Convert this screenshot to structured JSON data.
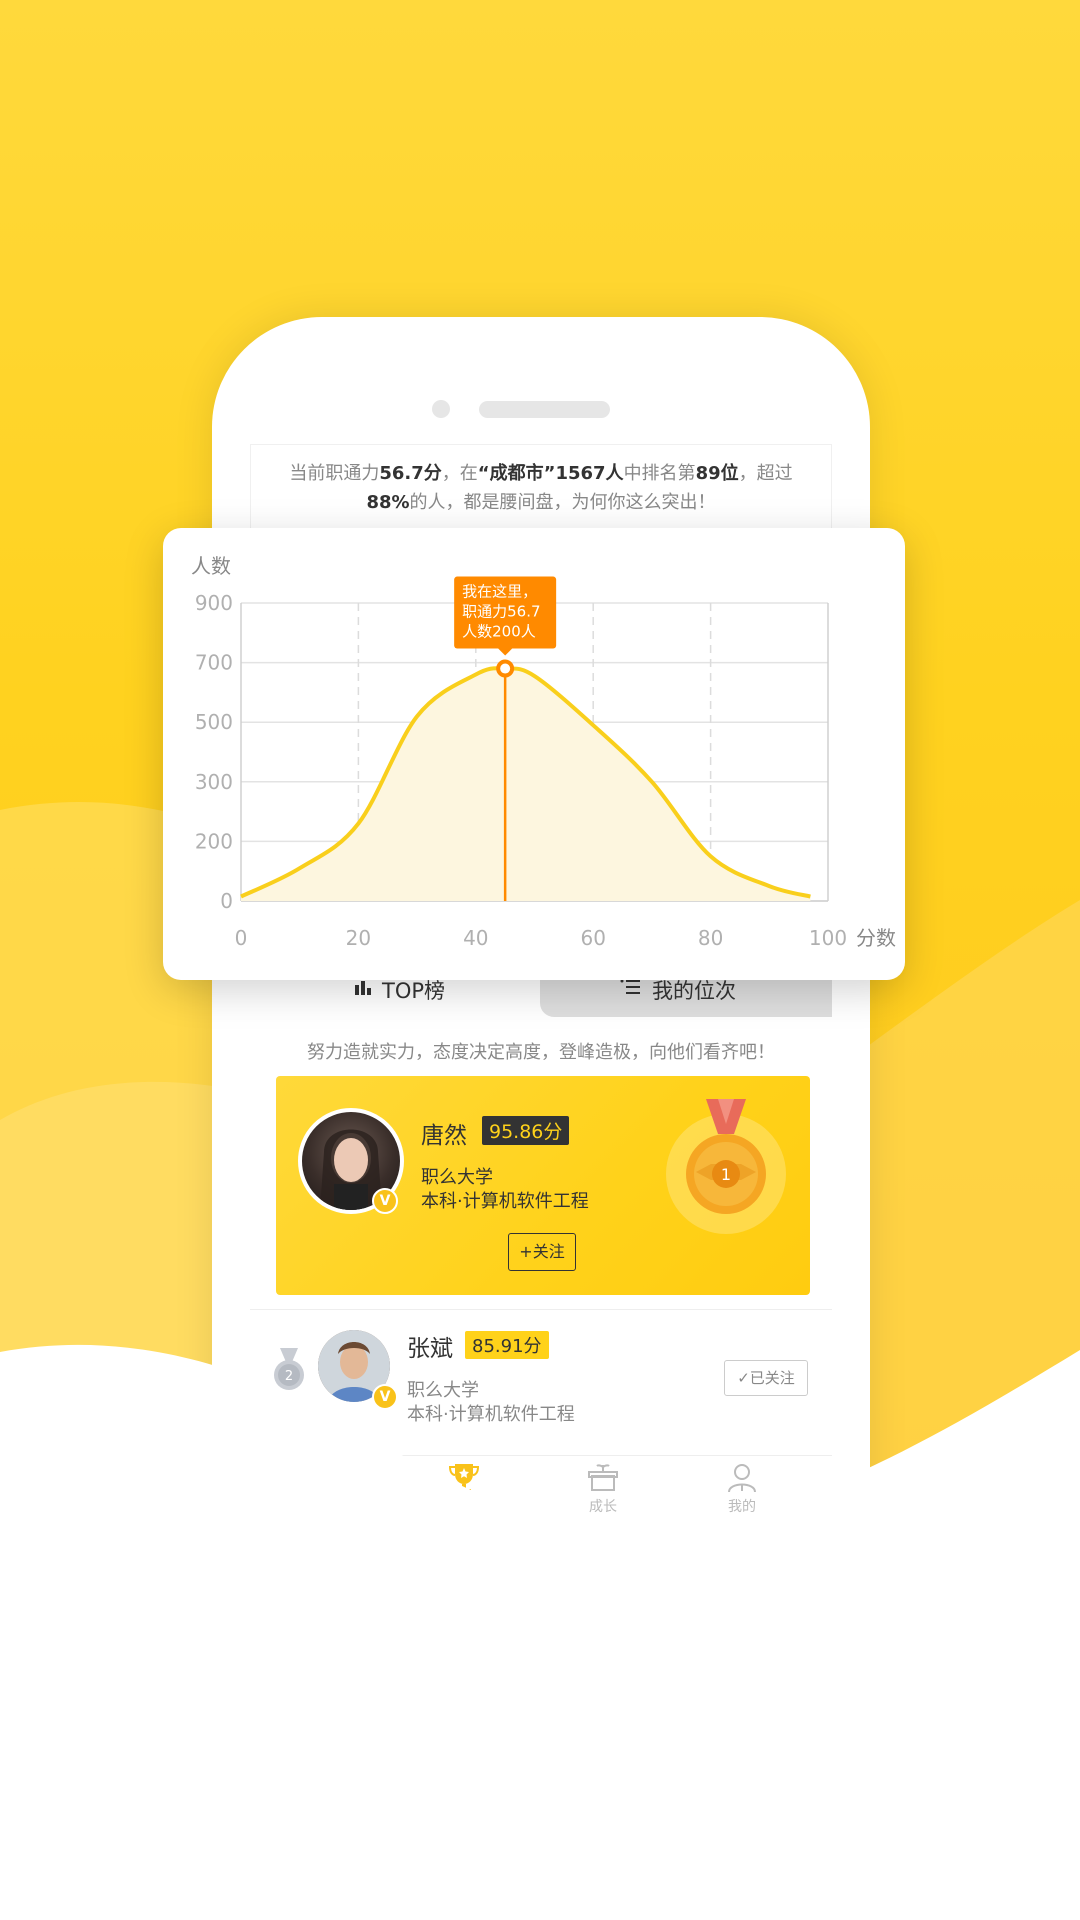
{
  "info": {
    "p1": "当前职通力",
    "score": "56.7分",
    "p2": "，在",
    "city": "“成都市”1567人",
    "p3": "中排名第",
    "rank": "89位",
    "p4": "，超过",
    "percent": "88%",
    "p5": "的人，都是腰间盘，为何你这么突出！"
  },
  "chart_data": {
    "type": "area",
    "ylabel": "人数",
    "xlabel": "分数",
    "y_ticks": [
      0,
      200,
      300,
      500,
      700,
      900
    ],
    "x_ticks": [
      0,
      20,
      40,
      60,
      80,
      100
    ],
    "x": [
      0,
      10,
      20,
      30,
      40,
      45,
      50,
      60,
      70,
      80,
      90,
      97
    ],
    "y": [
      15,
      110,
      230,
      520,
      660,
      680,
      655,
      490,
      300,
      150,
      50,
      15
    ],
    "marker": {
      "x": 45,
      "y": 680
    },
    "tooltip": [
      "我在这里，",
      "职通力56.7",
      "人数200人"
    ],
    "colors": {
      "line": "#f9cf1c",
      "fill": "#fdf6df",
      "marker": "#ff8a00"
    }
  },
  "tabs": {
    "top": "TOP榜",
    "mine": "我的位次"
  },
  "motto": "努力造就实力，态度决定高度，登峰造极，向他们看齐吧！",
  "first": {
    "name": "唐然",
    "score": "95.86分",
    "school": "职么大学",
    "major": "本科·计算机软件工程",
    "follow": "+关注",
    "medal_number": "1"
  },
  "second": {
    "rank": "2",
    "name": "张斌",
    "score": "85.91分",
    "school": "职么大学",
    "major": "本科·计算机软件工程",
    "followed": "✓已关注"
  },
  "nav": {
    "rank": "排名",
    "grow": "成长",
    "mine": "我的"
  },
  "badge": "V"
}
